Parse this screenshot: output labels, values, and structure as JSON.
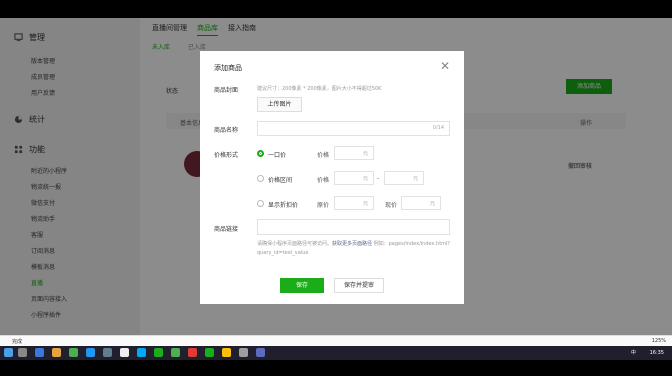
{
  "sidebar": {
    "sections": [
      {
        "label": "管理",
        "icon": "monitor-icon",
        "items": [
          "版本管理",
          "成员管理",
          "用户反馈"
        ]
      },
      {
        "label": "统计",
        "icon": "pie-chart-icon",
        "items": []
      },
      {
        "label": "功能",
        "icon": "grid-icon",
        "items": [
          "附近的小程序",
          "物流统一报",
          "微信支付",
          "物流助手",
          "客服",
          "订阅消息",
          "模板消息",
          "直播",
          "页面内容接入",
          "小程序插件"
        ]
      }
    ],
    "active_item": "直播"
  },
  "main": {
    "tabs": [
      "直播间管理",
      "商品库",
      "接入指南"
    ],
    "active_tab": "商品库",
    "subtabs": [
      "未入库",
      "已入库"
    ],
    "status_label": "状态",
    "add_button": "添加商品",
    "table_col_name": "基本信息",
    "table_col_op": "操作",
    "row_op": "撤回审核"
  },
  "modal": {
    "title": "添加商品",
    "cover_label": "商品封面",
    "cover_hint": "建议尺寸：200像素 * 200像素，图片大小不得超过50K",
    "upload_button": "上传图片",
    "name_label": "商品名称",
    "name_count": "0/14",
    "price_label": "价格形式",
    "price_options": [
      "一口价",
      "价格区间",
      "显示折扣价"
    ],
    "price_field": "价格",
    "original_price": "原价",
    "current_price": "现价",
    "unit": "元",
    "range_sep": "-",
    "link_label": "商品链接",
    "link_hint_prefix": "请确保小程序页面路径可被访问。",
    "link_hint_link": "获取更多页面路径",
    "link_hint_suffix": " 例如：pages/index/index.html?query_id=test_value",
    "save_button": "保存",
    "save_submit_button": "保存并提审"
  },
  "statusbar": {
    "left": "完成",
    "zoom": "125%"
  },
  "taskbar": {
    "time": "16:35",
    "ime": "中"
  },
  "colors": {
    "accent": "#1aad19",
    "link": "#576b95"
  }
}
